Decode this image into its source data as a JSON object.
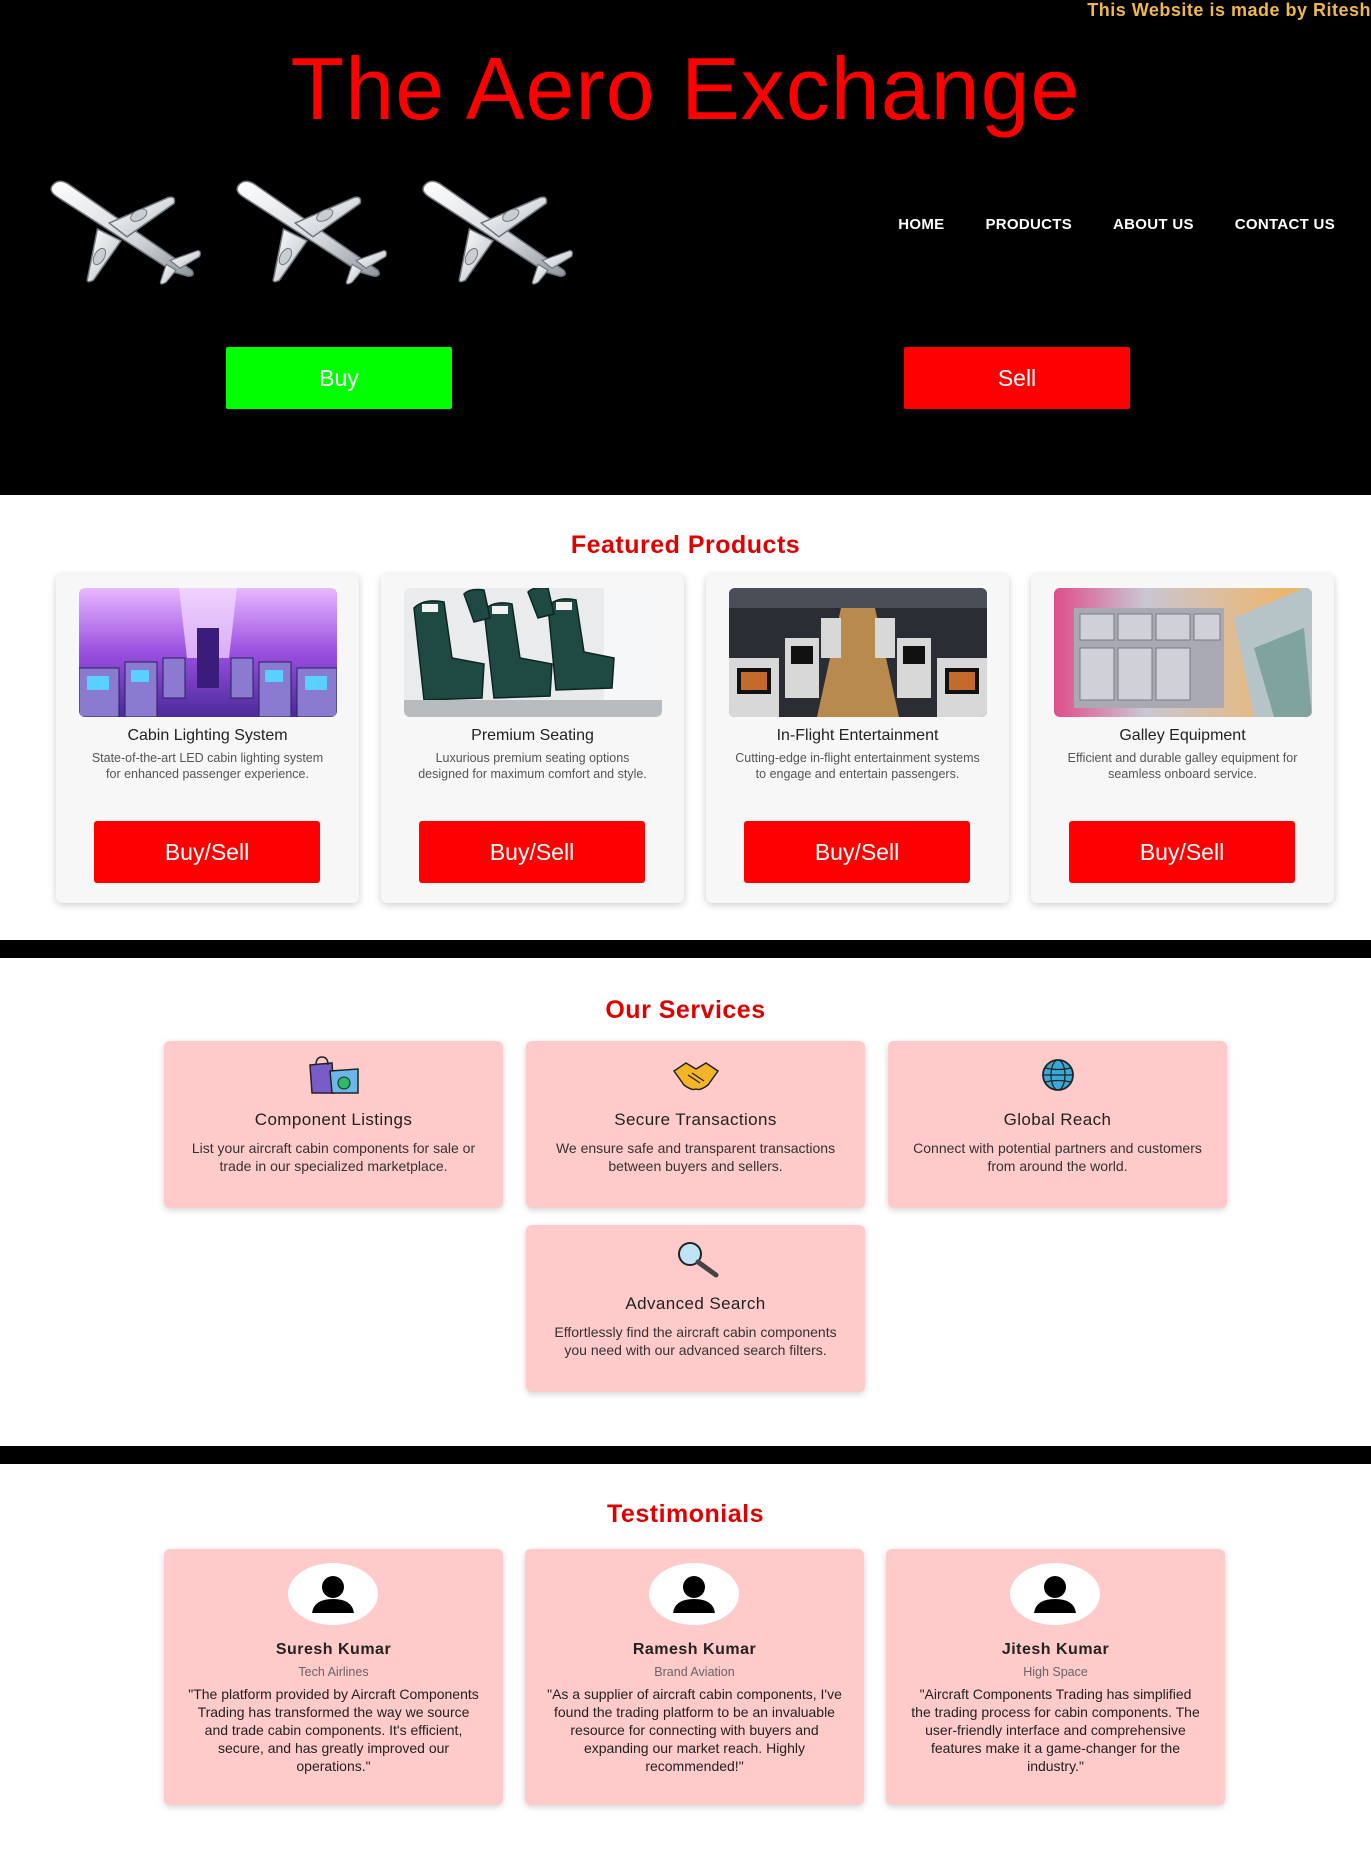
{
  "header": {
    "credit": "This Website is made by Ritesh",
    "title": "The Aero Exchange",
    "nav": [
      "HOME",
      "PRODUCTS",
      "ABOUT US",
      "CONTACT US"
    ],
    "buy_label": "Buy",
    "sell_label": "Sell",
    "colors": {
      "title": "#ff0000",
      "buy": "#00ff00",
      "sell": "#ff0000",
      "credit": "#f0b84a"
    },
    "decoration_icons": [
      "airplane-icon",
      "airplane-icon",
      "airplane-icon"
    ]
  },
  "featured": {
    "title": "Featured Products",
    "products": [
      {
        "name": "Cabin Lighting System",
        "desc": "State-of-the-art LED cabin lighting system for enhanced passenger experience.",
        "button": "Buy/Sell",
        "image": "cabin-lighting-photo"
      },
      {
        "name": "Premium Seating",
        "desc": "Luxurious premium seating options designed for maximum comfort and style.",
        "button": "Buy/Sell",
        "image": "premium-seating-photo"
      },
      {
        "name": "In-Flight Entertainment",
        "desc": "Cutting-edge in-flight entertainment systems to engage and entertain passengers.",
        "button": "Buy/Sell",
        "image": "inflight-entertainment-photo"
      },
      {
        "name": "Galley Equipment",
        "desc": "Efficient and durable galley equipment for seamless onboard service.",
        "button": "Buy/Sell",
        "image": "galley-equipment-photo"
      }
    ]
  },
  "services": {
    "title": "Our Services",
    "items": [
      {
        "title": "Component Listings",
        "desc": "List your aircraft cabin components for sale or trade in our specialized marketplace.",
        "icon": "shopping-bags-icon"
      },
      {
        "title": "Secure Transactions",
        "desc": "We ensure safe and transparent transactions between buyers and sellers.",
        "icon": "handshake-icon"
      },
      {
        "title": "Global Reach",
        "desc": "Connect with potential partners and customers from around the world.",
        "icon": "globe-icon"
      },
      {
        "title": "Advanced Search",
        "desc": "Effortlessly find the aircraft cabin components you need with our advanced search filters.",
        "icon": "magnifier-icon"
      }
    ]
  },
  "testimonials": {
    "title": "Testimonials",
    "items": [
      {
        "name": "Suresh Kumar",
        "company": "Tech Airlines",
        "quote": "\"The platform provided by Aircraft Components Trading has transformed the way we source and trade cabin components. It's efficient, secure, and has greatly improved our operations.\""
      },
      {
        "name": "Ramesh Kumar",
        "company": "Brand Aviation",
        "quote": "\"As a supplier of aircraft cabin components, I've found the trading platform to be an invaluable resource for connecting with buyers and expanding our market reach. Highly recommended!\""
      },
      {
        "name": "Jitesh Kumar",
        "company": "High Space",
        "quote": "\"Aircraft Components Trading has simplified the trading process for cabin components. The user-friendly interface and comprehensive features make it a game-changer for the industry.\""
      }
    ]
  }
}
